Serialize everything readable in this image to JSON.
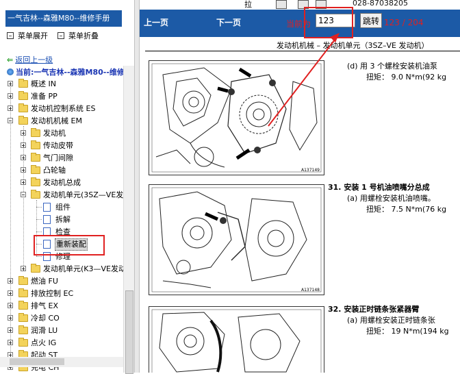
{
  "left": {
    "title": "一气吉林--森雅M80--维修手册",
    "expand_all": "菜单展开",
    "collapse_all": "菜单折叠",
    "back": "返回上一级",
    "current": "当前:一气吉林--森雅M80--维修手"
  },
  "tree": [
    {
      "label": "概述 IN"
    },
    {
      "label": "准备 PP"
    },
    {
      "label": "发动机控制系统 ES"
    },
    {
      "label": "发动机机械 EM"
    },
    {
      "label": "发动机"
    },
    {
      "label": "传动皮带"
    },
    {
      "label": "气门间隙"
    },
    {
      "label": "凸轮轴"
    },
    {
      "label": "发动机总成"
    },
    {
      "label": "发动机单元(3SZ—VE发"
    },
    {
      "label": "组件"
    },
    {
      "label": "拆解"
    },
    {
      "label": "检查"
    },
    {
      "label": "重新装配"
    },
    {
      "label": "修理"
    },
    {
      "label": "发动机单元(K3—VE发动"
    },
    {
      "label": "燃油 FU"
    },
    {
      "label": "排放控制 EC"
    },
    {
      "label": "排气 EX"
    },
    {
      "label": "冷却 CO"
    },
    {
      "label": "润滑 LU"
    },
    {
      "label": "点火 IG"
    },
    {
      "label": "起动 ST"
    },
    {
      "label": "充电 CH"
    }
  ],
  "toolbar": {
    "prev": "上一页",
    "next": "下一页",
    "current_label": "当前为",
    "page_value": "123",
    "jump": "跳转",
    "page_count": "123 / 204"
  },
  "top_strip": {
    "text": "拉",
    "phone": "028-87038205"
  },
  "doc": {
    "header": "发动机机械 – 发动机单元（3SZ–VE 发动机）",
    "fig1_id": "A137149",
    "fig2_id": "A137148",
    "d_step": "(d)  用 3 个螺栓安装机油泵",
    "d_torque": "扭矩：  9.0 N*m(92 kg",
    "s31": "31.  安装 1 号机油喷嘴分总成",
    "s31a": "(a)  用螺栓安装机油喷嘴。",
    "s31a_torque": "扭矩：  7.5 N*m(76 kg",
    "s32": "32.  安装正时链条张紧器臂",
    "s32a": "(a)  用螺栓安装正时链条张",
    "s32a_torque": "扭矩：  19 N*m(194 kg"
  },
  "colors": {
    "toolbar": "#1c5aa6",
    "accent_red": "#e02020",
    "link_blue": "#1a4fb3"
  }
}
